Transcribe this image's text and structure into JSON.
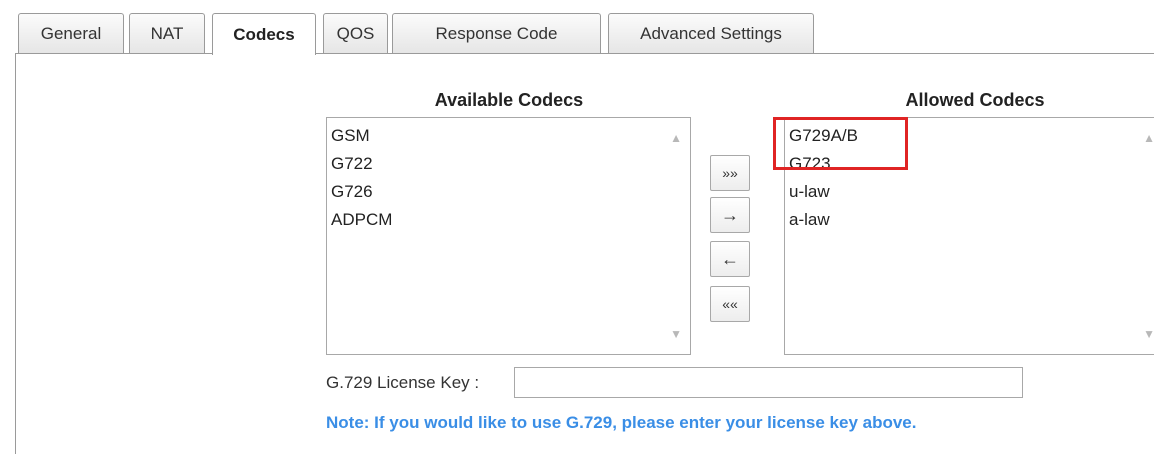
{
  "tabs": [
    {
      "label": "General"
    },
    {
      "label": "NAT"
    },
    {
      "label": "Codecs"
    },
    {
      "label": "QOS"
    },
    {
      "label": "Response Code"
    },
    {
      "label": "Advanced Settings"
    }
  ],
  "active_tab": "Codecs",
  "available": {
    "heading": "Available Codecs",
    "items": [
      "GSM",
      "G722",
      "G726",
      "ADPCM"
    ]
  },
  "allowed": {
    "heading": "Allowed Codecs",
    "items": [
      "G729A/B",
      "G723",
      "u-law",
      "a-law"
    ]
  },
  "buttons": {
    "add_all": "»»",
    "add": "→",
    "remove": "←",
    "remove_all": "««"
  },
  "license": {
    "label": "G.729 License Key :",
    "value": ""
  },
  "note": "Note: If you would like to use G.729, please enter your license key above.",
  "colors": {
    "note": "#3a8ee6",
    "highlight": "#e02424"
  }
}
